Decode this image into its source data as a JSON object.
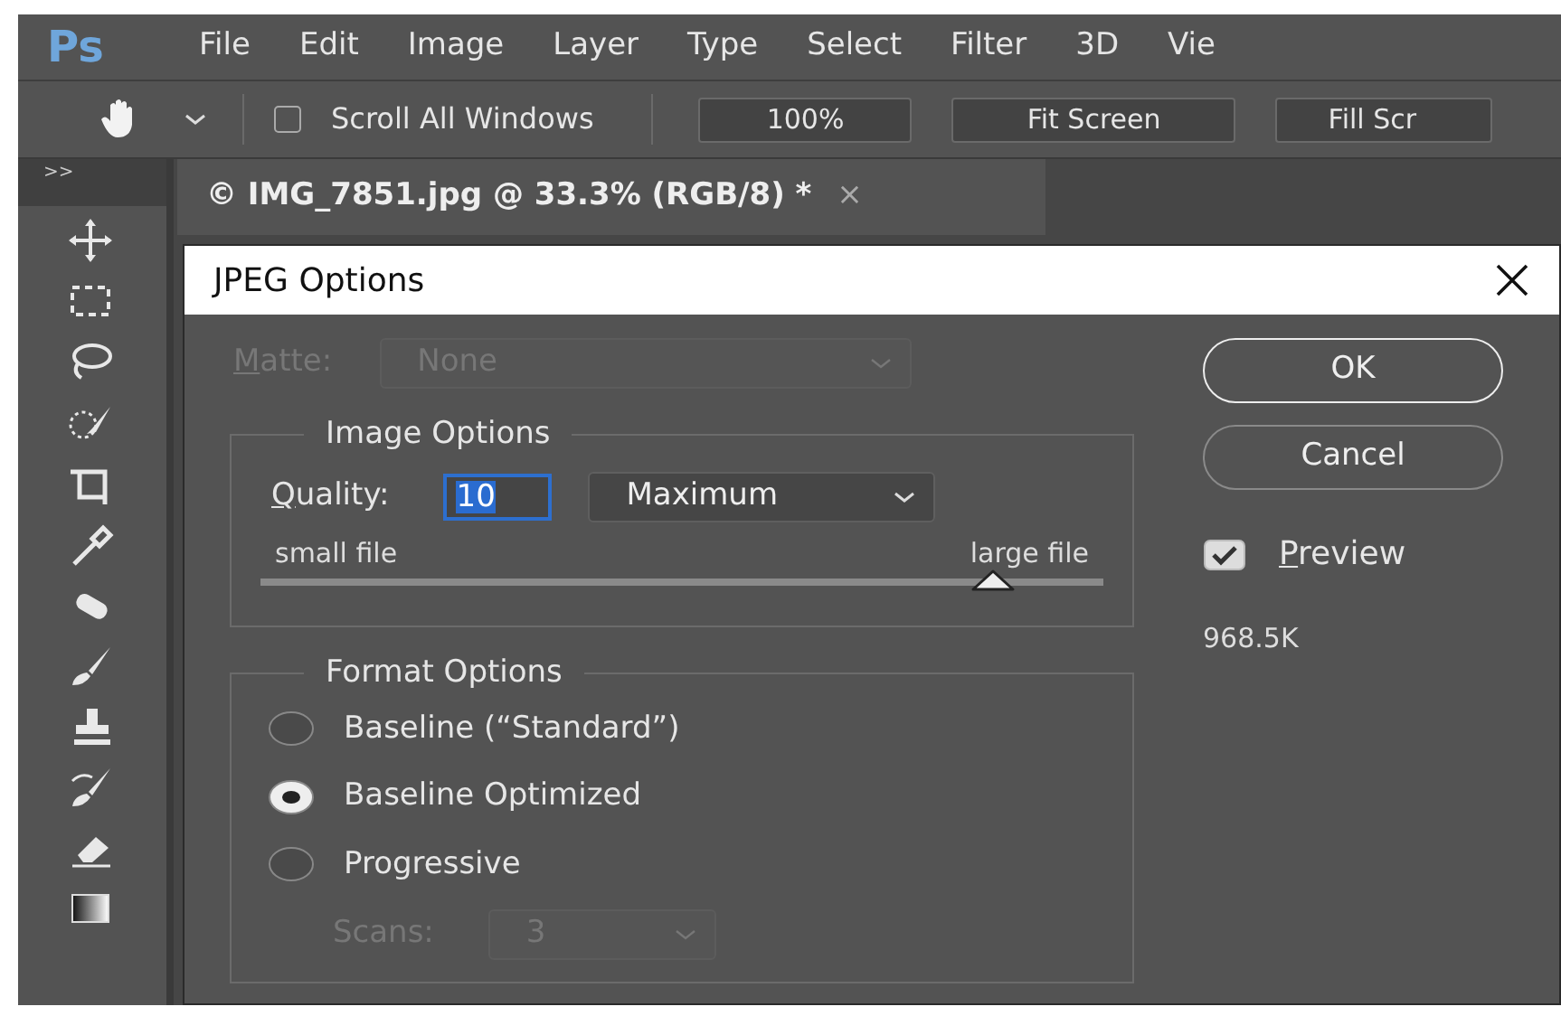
{
  "app": {
    "logo": "Ps",
    "menu": [
      "File",
      "Edit",
      "Image",
      "Layer",
      "Type",
      "Select",
      "Filter",
      "3D",
      "Vie"
    ]
  },
  "options_bar": {
    "scroll_all_windows": {
      "label": "Scroll All Windows",
      "checked": false
    },
    "buttons": [
      "100%",
      "Fit Screen",
      "Fill Scr"
    ]
  },
  "panel_toggle": ">>",
  "document_tab": {
    "title": "© IMG_7851.jpg @ 33.3% (RGB/8) *",
    "close": "×"
  },
  "dialog": {
    "title": "JPEG Options",
    "matte": {
      "label": "Matte:",
      "mnemonic": true,
      "value": "None",
      "disabled": true
    },
    "image_options": {
      "title": "Image Options",
      "quality_label": "Quality:",
      "mnemonic": true,
      "quality": "10",
      "preset": "Maximum",
      "min_label": "small file",
      "max_label": "large file",
      "level": 0.87
    },
    "format_options": {
      "title": "Format Options",
      "choices": [
        {
          "label": "Baseline (“Standard”)",
          "selected": false
        },
        {
          "label": "Baseline Optimized",
          "selected": true
        },
        {
          "label": "Progressive",
          "selected": false
        }
      ],
      "scans": {
        "label": "Scans:",
        "value": "3",
        "disabled": true
      }
    },
    "buttons": [
      {
        "label": "OK",
        "default": true
      },
      {
        "label": "Cancel",
        "default": false
      }
    ],
    "preview": {
      "label": "Preview",
      "mnemonic": true,
      "checked": true
    },
    "file_size": "968.5K"
  }
}
